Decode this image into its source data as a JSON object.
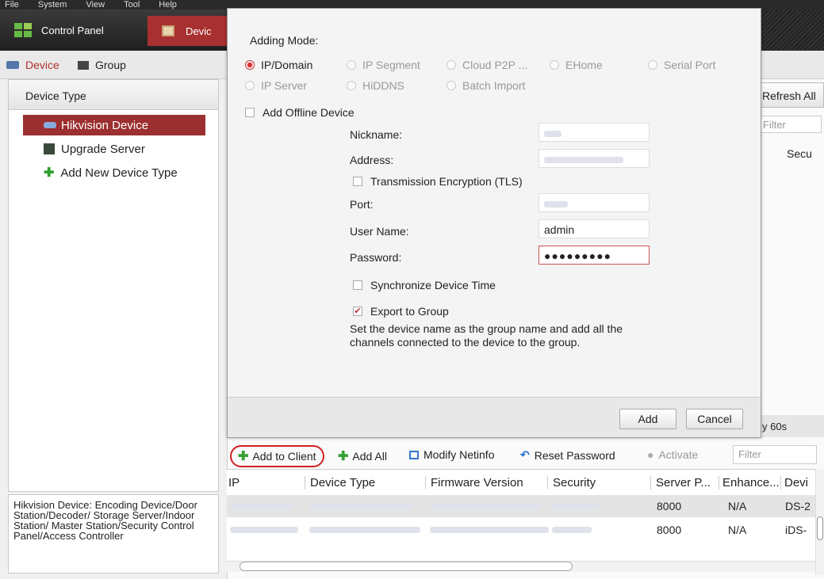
{
  "menubar": {
    "items": [
      "File",
      "System",
      "View",
      "Tool",
      "Help"
    ]
  },
  "titlebar": {
    "tab_control_panel": "Control Panel",
    "tab_device": "Devic"
  },
  "subtabs": {
    "device": "Device",
    "group": "Group"
  },
  "left_panel": {
    "header": "Device Type",
    "items": [
      "Hikvision Device",
      "Upgrade Server",
      "Add New Device Type"
    ],
    "description": "Hikvision Device: Encoding Device/Door Station/Decoder/ Storage Server/Indoor Station/ Master Station/Security Control Panel/Access Controller"
  },
  "background": {
    "refresh_all": "Refresh All",
    "filter": "Filter",
    "col_security": "Secu",
    "refresh_60": "y 60s"
  },
  "dialog": {
    "adding_mode_label": "Adding Mode:",
    "modes": [
      "IP/Domain",
      "IP Segment",
      "Cloud P2P ...",
      "EHome",
      "Serial Port",
      "IP Server",
      "HiDDNS",
      "Batch Import"
    ],
    "selected_mode": "IP/Domain",
    "add_offline": "Add Offline Device",
    "nickname_label": "Nickname:",
    "address_label": "Address:",
    "tls_label": "Transmission Encryption (TLS)",
    "port_label": "Port:",
    "username_label": "User Name:",
    "username_value": "admin",
    "password_label": "Password:",
    "password_value": "●●●●●●●●●",
    "sync_time_label": "Synchronize Device Time",
    "export_group_label": "Export to Group",
    "export_group_checked": true,
    "export_note": "Set the device name as the group name and add all the channels connected to the device to the group.",
    "add_button": "Add",
    "cancel_button": "Cancel"
  },
  "toolbar": {
    "add_to_client": "Add to Client",
    "add_all": "Add All",
    "modify_netinfo": "Modify Netinfo",
    "reset_password": "Reset Password",
    "activate": "Activate",
    "filter_placeholder": "Filter"
  },
  "table": {
    "columns": [
      "IP",
      "Device Type",
      "Firmware Version",
      "Security",
      "Server P...",
      "Enhance...",
      "Devi"
    ],
    "rows": [
      {
        "server_port": "8000",
        "enhanced": "N/A",
        "device": "DS-2"
      },
      {
        "server_port": "8000",
        "enhanced": "N/A",
        "device": "iDS-"
      }
    ]
  },
  "colors": {
    "accent": "#a83030",
    "selection": "#9c2f2f",
    "add_green": "#33a033"
  }
}
